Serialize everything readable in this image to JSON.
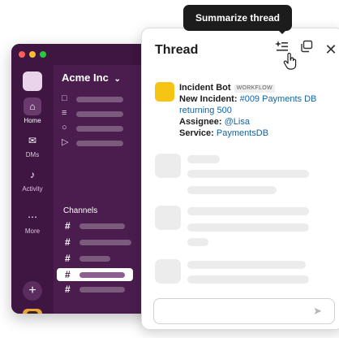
{
  "tooltip": {
    "text": "Summarize thread"
  },
  "workspace": {
    "name": "Acme Inc",
    "chevron": "⌄"
  },
  "rail": {
    "items": [
      {
        "label": "Home",
        "icon": "home-icon",
        "glyph": "⌂"
      },
      {
        "label": "DMs",
        "icon": "dm-icon",
        "glyph": "✉"
      },
      {
        "label": "Activity",
        "icon": "bell-icon",
        "glyph": "♪"
      },
      {
        "label": "More",
        "icon": "more-icon",
        "glyph": "⋯"
      }
    ],
    "add_glyph": "+"
  },
  "sidebar": {
    "channels_label": "Channels",
    "hash": "#"
  },
  "thread": {
    "title": "Thread",
    "icons": {
      "summarize": "✧",
      "popout": "⧉",
      "close": "✕"
    },
    "message": {
      "sender": "Incident Bot",
      "tag": "WORKFLOW",
      "line1_label": "New Incident:",
      "line1_link": "#009 Payments DB returning 500",
      "line2_label": "Assignee:",
      "line2_link": "@Lisa",
      "line3_label": "Service:",
      "line3_link": "PaymentsDB"
    },
    "send_glyph": "➤"
  },
  "colors": {
    "aubergine": "#4a1d4e",
    "aubergine_dark": "#3e1641",
    "link": "#1264a3",
    "bot_avatar": "#f5c415",
    "tooltip_bg": "#1d1c1d"
  }
}
